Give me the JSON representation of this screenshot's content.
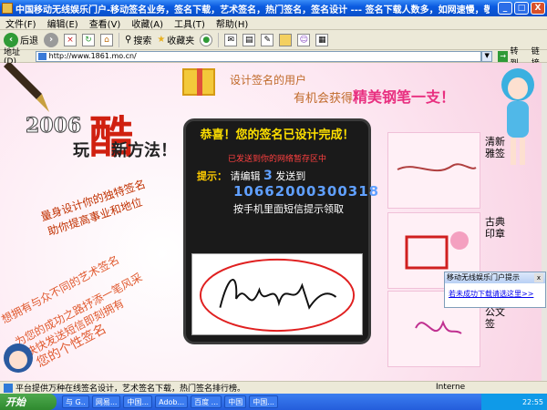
{
  "window": {
    "title": "中国移动无线娱乐门户-移动签名业务，签名下载，艺术签名，热门签名，签名设计 --- 签名下载人数多，如网速慢，敬请稍后！ - Microsoft...",
    "min_label": "_",
    "max_label": "□",
    "close_label": "X"
  },
  "menu": [
    "文件(F)",
    "编辑(E)",
    "查看(V)",
    "收藏(A)",
    "工具(T)",
    "帮助(H)"
  ],
  "toolbar": {
    "back_label": "后退",
    "back_icon": "back-arrow-icon",
    "forward_icon": "forward-arrow-icon",
    "search_label": "搜索",
    "favorites_label": "收藏夹"
  },
  "address": {
    "label": "地址(D)",
    "url": "http://www.1861.mo.cn/",
    "go_label": "转到",
    "links_label": "链接"
  },
  "page": {
    "slogan_top": "设计签名的用户",
    "slogan_bottom_prefix": "有机会获得",
    "slogan_bottom_highlight": "精美钢笔一支！",
    "brand_year": "2006",
    "brand_ku": "酷",
    "brand_wan": "玩",
    "brand_new": "新方法！",
    "promo_line1": "量身设计你的独特签名",
    "promo_line2": "助你提高事业和地位",
    "left_text": [
      "想拥有与众不同的艺术签名",
      "为您的成功之路抒添一笔风采",
      "快快发送短信即刻拥有",
      "您的个性签名"
    ]
  },
  "panel": {
    "title": "恭喜！您的签名已设计完成！",
    "subtitle": "已发送到你的网络暂存区中",
    "tip_label": "提示：",
    "tip_prefix": "请编辑",
    "tip_number": "3",
    "tip_suffix": "发送到",
    "phone": "10662000300318",
    "hint": "按手机里面短信提示领取"
  },
  "samples": [
    {
      "label": "清新雅签"
    },
    {
      "label": "古典印章"
    },
    {
      "label": "简单公文签"
    }
  ],
  "popup": {
    "title": "移动无线娱乐门户提示",
    "body": "若未成功下载请选这里>>",
    "close_label": "x"
  },
  "status": {
    "text": "平台提供万种在线签名设计，艺术签名下载，热门签名排行榜。",
    "zone": "Interne"
  },
  "taskbar": {
    "start_label": "开始",
    "tasks": [
      "与 G..",
      "网易...",
      "中国...",
      "Adob...",
      "百度 ...",
      "中国",
      "中国..."
    ],
    "clock": "22:55"
  }
}
